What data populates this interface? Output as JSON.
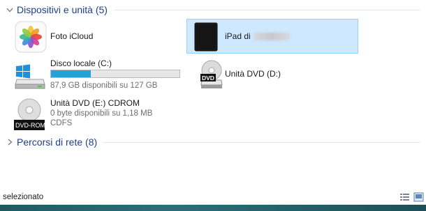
{
  "groups": {
    "devices": {
      "title": "Dispositivi e unità (5)"
    },
    "network": {
      "title": "Percorsi di rete (8)"
    }
  },
  "items": {
    "foto_icloud": {
      "name": "Foto iCloud",
      "icon": "photos-icon"
    },
    "ipad": {
      "name": "iPad di",
      "icon": "ipad-icon",
      "name_blurred": true
    },
    "disco_locale": {
      "name": "Disco locale (C:)",
      "free": "87,9 GB disponibili su 127 GB",
      "usage_fraction": 0.31,
      "icon": "windows-drive-icon"
    },
    "dvd_d": {
      "name": "Unità DVD (D:)",
      "icon": "dvd-drive-icon",
      "badge": "DVD"
    },
    "dvd_e": {
      "name": "Unità DVD (E:) CDROM",
      "free": "0 byte disponibili su 1,18 MB",
      "fs": "CDFS",
      "icon": "dvd-rom-disc-icon",
      "badge": "DVD-ROM"
    }
  },
  "status": {
    "text": "selezionato"
  },
  "colors": {
    "group_title": "#1e3f8b",
    "selection_bg": "#cde8ff",
    "selection_border": "#99d1ff",
    "usage_fill": "#26a0da"
  }
}
